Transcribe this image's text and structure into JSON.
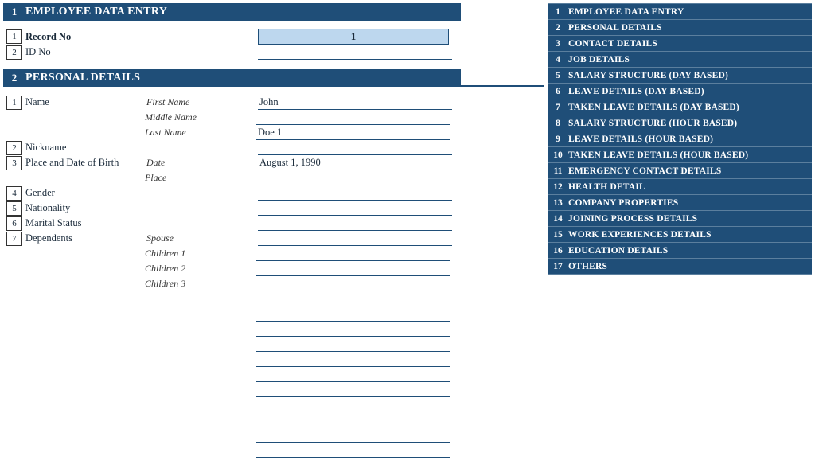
{
  "sections": {
    "s1": {
      "num": "1",
      "title": "EMPLOYEE DATA ENTRY"
    },
    "s2": {
      "num": "2",
      "title": "PERSONAL DETAILS"
    }
  },
  "form": {
    "record_no": {
      "num": "1",
      "label": "Record No",
      "value": "1"
    },
    "id_no": {
      "num": "2",
      "label": "ID No",
      "value": ""
    },
    "name": {
      "num": "1",
      "label": "Name",
      "first_label": "First Name",
      "first_value": "John",
      "middle_label": "Middle Name",
      "middle_value": "",
      "last_label": "Last Name",
      "last_value": "Doe 1"
    },
    "nickname": {
      "num": "2",
      "label": "Nickname",
      "value": ""
    },
    "birth": {
      "num": "3",
      "label": "Place and Date of Birth",
      "date_label": "Date",
      "date_value": "August 1, 1990",
      "place_label": "Place",
      "place_value": ""
    },
    "gender": {
      "num": "4",
      "label": "Gender",
      "value": ""
    },
    "nationality": {
      "num": "5",
      "label": "Nationality",
      "value": ""
    },
    "marital": {
      "num": "6",
      "label": "Marital Status",
      "value": ""
    },
    "dependents": {
      "num": "7",
      "label": "Dependents",
      "spouse_label": "Spouse",
      "c1_label": "Children 1",
      "c2_label": "Children 2",
      "c3_label": "Children 3"
    }
  },
  "nav": [
    {
      "num": "1",
      "label": "EMPLOYEE DATA ENTRY"
    },
    {
      "num": "2",
      "label": "PERSONAL DETAILS"
    },
    {
      "num": "3",
      "label": "CONTACT DETAILS"
    },
    {
      "num": "4",
      "label": "JOB DETAILS"
    },
    {
      "num": "5",
      "label": "SALARY STRUCTURE (DAY BASED)"
    },
    {
      "num": "6",
      "label": "LEAVE DETAILS (DAY BASED)"
    },
    {
      "num": "7",
      "label": "TAKEN LEAVE DETAILS (DAY BASED)"
    },
    {
      "num": "8",
      "label": "SALARY STRUCTURE (HOUR BASED)"
    },
    {
      "num": "9",
      "label": "LEAVE DETAILS (HOUR BASED)"
    },
    {
      "num": "10",
      "label": "TAKEN LEAVE DETAILS (HOUR BASED)"
    },
    {
      "num": "11",
      "label": "EMERGENCY CONTACT DETAILS"
    },
    {
      "num": "12",
      "label": "HEALTH DETAIL"
    },
    {
      "num": "13",
      "label": "COMPANY PROPERTIES"
    },
    {
      "num": "14",
      "label": "JOINING PROCESS DETAILS"
    },
    {
      "num": "15",
      "label": "WORK EXPERIENCES DETAILS"
    },
    {
      "num": "16",
      "label": "EDUCATION DETAILS"
    },
    {
      "num": "17",
      "label": "OTHERS"
    }
  ]
}
